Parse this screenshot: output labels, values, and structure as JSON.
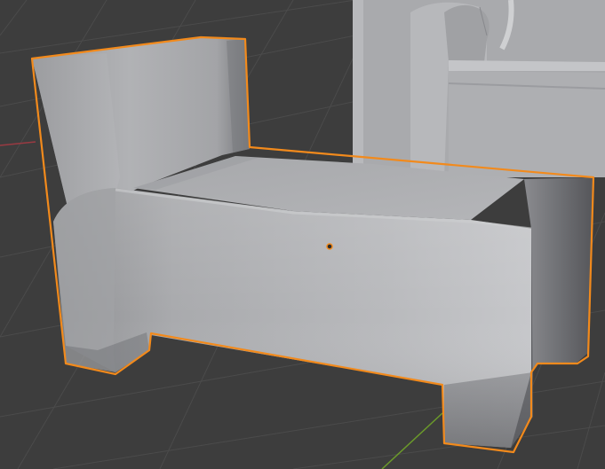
{
  "viewport": {
    "background_color": "#3d3d3d",
    "grid_color": "#4a4a4a",
    "x_axis_color": "#9a3a42",
    "y_axis_color": "#6b9a2a"
  },
  "selected_object": {
    "name": "",
    "outline_color": "#f28a1c",
    "origin_color": "#f28a1c",
    "is_active": true
  },
  "background_object": {
    "description_visible": false
  }
}
